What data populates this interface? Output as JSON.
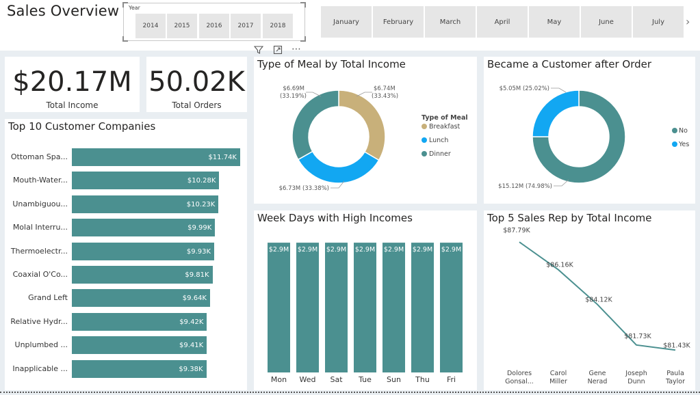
{
  "header": {
    "title": "Sales Overview",
    "year_slicer": {
      "label": "Year",
      "years": [
        "2014",
        "2015",
        "2016",
        "2017",
        "2018"
      ]
    },
    "month_slicer": {
      "months": [
        "January",
        "February",
        "March",
        "April",
        "May",
        "June",
        "July"
      ],
      "next_icon": "chevron-right-icon"
    },
    "visual_header_icons": [
      "filter-icon",
      "focus-mode-icon",
      "more-options-icon"
    ]
  },
  "kpis": {
    "total_income": {
      "value": "$20.17M",
      "label": "Total Income"
    },
    "total_orders": {
      "value": "50.02K",
      "label": "Total Orders"
    }
  },
  "colors": {
    "teal": "#4b9090",
    "tan": "#c8b07a",
    "blue": "#12a7f2",
    "panel_bg": "#ffffff",
    "page_bg": "#e9eef2"
  },
  "chart_data": [
    {
      "id": "top10",
      "type": "bar",
      "orientation": "horizontal",
      "title": "Top 10 Customer Companies",
      "categories": [
        "Ottoman Spa...",
        "Mouth-Water...",
        "Unambiguou...",
        "Molal Interru...",
        "Thermoelectr...",
        "Coaxial O'Co...",
        "Grand Left",
        "Relative Hydr...",
        "Unplumbed ...",
        "Inapplicable ..."
      ],
      "values": [
        11.74,
        10.28,
        10.23,
        9.99,
        9.93,
        9.81,
        9.64,
        9.42,
        9.41,
        9.38
      ],
      "value_labels": [
        "$11.74K",
        "$10.28K",
        "$10.23K",
        "$9.99K",
        "$9.93K",
        "$9.81K",
        "$9.64K",
        "$9.42K",
        "$9.41K",
        "$9.38K"
      ],
      "units": "K$",
      "xlim": [
        0,
        11.74
      ]
    },
    {
      "id": "meal",
      "type": "pie",
      "donut": true,
      "title": "Type of Meal by Total Income",
      "legend_title": "Type of Meal",
      "legend_position": "right",
      "labels": [
        "Breakfast",
        "Lunch",
        "Dinner"
      ],
      "values": [
        6.74,
        6.73,
        6.69
      ],
      "percents": [
        "33.43%",
        "33.38%",
        "33.19%"
      ],
      "value_labels": [
        "$6.74M",
        "$6.73M",
        "$6.69M"
      ],
      "colors": [
        "#c8b07a",
        "#12a7f2",
        "#4b9090"
      ]
    },
    {
      "id": "customer",
      "type": "pie",
      "donut": true,
      "title": "Became a Customer after Order",
      "legend_position": "right",
      "labels": [
        "No",
        "Yes"
      ],
      "values": [
        15.12,
        5.05
      ],
      "percents": [
        "74.98%",
        "25.02%"
      ],
      "value_labels": [
        "$15.12M",
        "$5.05M"
      ],
      "colors": [
        "#4b9090",
        "#12a7f2"
      ]
    },
    {
      "id": "weekdays",
      "type": "bar",
      "title": "Week Days with High Incomes",
      "categories": [
        "Mon",
        "Wed",
        "Sat",
        "Tue",
        "Sun",
        "Thu",
        "Fri"
      ],
      "values": [
        2.9,
        2.9,
        2.9,
        2.9,
        2.9,
        2.9,
        2.9
      ],
      "value_labels": [
        "$2.9M",
        "$2.9M",
        "$2.9M",
        "$2.9M",
        "$2.9M",
        "$2.9M",
        "$2.9M"
      ],
      "ylim": [
        0,
        3.1
      ]
    },
    {
      "id": "salesrep",
      "type": "line",
      "title": "Top 5 Sales Rep by Total Income",
      "categories": [
        [
          "Dolores",
          "Gonsal..."
        ],
        [
          "Carol",
          "Miller"
        ],
        [
          "Gene",
          "Nerad"
        ],
        [
          "Joseph",
          "Dunn"
        ],
        [
          "Paula",
          "Taylor"
        ]
      ],
      "values": [
        87.79,
        86.16,
        84.12,
        81.73,
        81.43
      ],
      "value_labels": [
        "$87.79K",
        "$86.16K",
        "$84.12K",
        "$81.73K",
        "$81.43K"
      ],
      "ylim": [
        81.2,
        88.2
      ]
    }
  ]
}
